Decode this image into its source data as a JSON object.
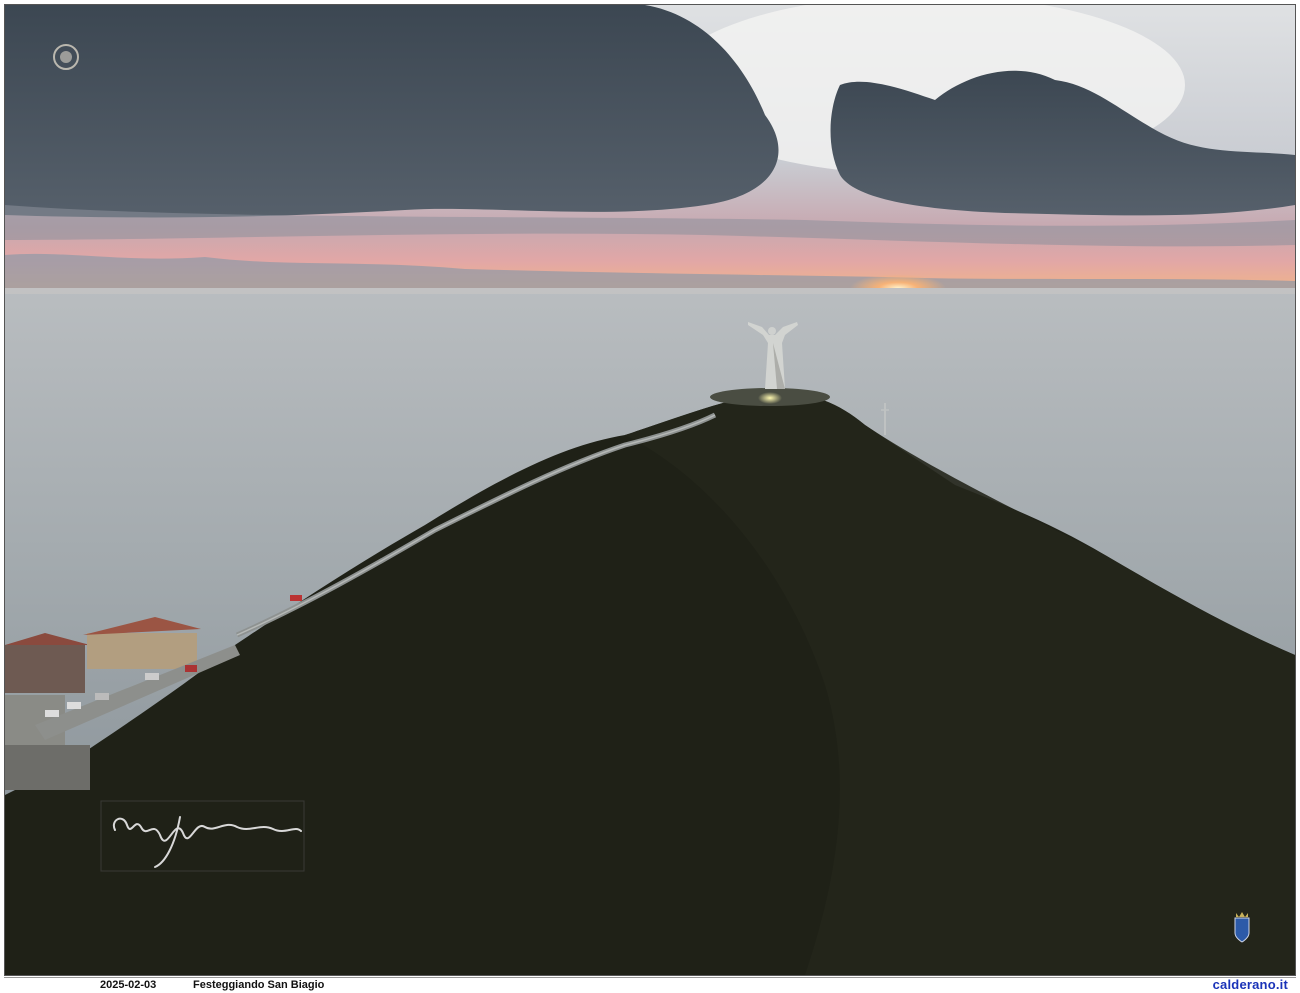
{
  "photo": {
    "subject": "Drone view of Christ the Redeemer statue on Monte San Biagio at sunset over the sea",
    "colors": {
      "sky_light": "#e8e9ea",
      "cloud_dark": "#4a5560",
      "horizon_pink": "#e2a7a6",
      "horizon_orange": "#f6b27a",
      "sea": "#9aa3a8",
      "mountain": "#1e2016",
      "statue": "#cfd1cf"
    },
    "icons": {
      "top_left_logo": "crest-logo-icon",
      "bottom_right_logo": "coat-of-arms-icon",
      "signature": "handwritten-signature"
    }
  },
  "caption": {
    "date": "2025-02-03",
    "title": "Festeggiando San Biagio",
    "site": "calderano.it"
  }
}
